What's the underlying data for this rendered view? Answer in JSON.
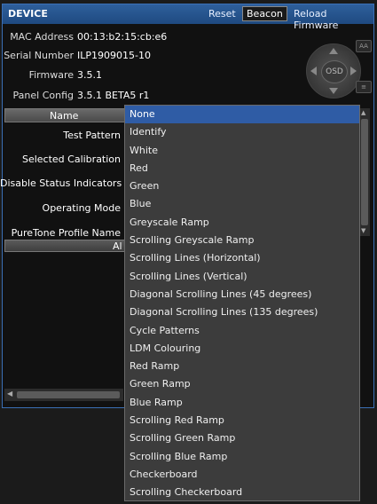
{
  "header": {
    "title": "DEVICE",
    "reset_label": "Reset",
    "beacon_label": "Beacon",
    "reload_label": "Reload Firmware"
  },
  "info": [
    {
      "label": "MAC Address",
      "value": "00:13:b2:15:cb:e6"
    },
    {
      "label": "Serial Number",
      "value": "ILP1909015-10"
    },
    {
      "label": "Firmware",
      "value": "3.5.1"
    },
    {
      "label": "Panel Config",
      "value": "3.5.1 BETA5 r1"
    }
  ],
  "osd": {
    "label": "OSD",
    "icon": "dpad-icon"
  },
  "table": {
    "name_header": "Name",
    "rows": [
      {
        "label": "Test Pattern"
      },
      {
        "label": "Selected Calibration"
      },
      {
        "label": "Disable Status Indicators"
      },
      {
        "label": "Operating Mode"
      },
      {
        "label": "PureTone Profile Name"
      }
    ],
    "footer_label": "Al"
  },
  "dropdown": {
    "selected": "None",
    "options": [
      "None",
      "Identify",
      "White",
      "Red",
      "Green",
      "Blue",
      "Greyscale Ramp",
      "Scrolling Greyscale Ramp",
      "Scrolling Lines (Horizontal)",
      "Scrolling Lines (Vertical)",
      "Diagonal Scrolling Lines (45 degrees)",
      "Diagonal Scrolling Lines (135 degrees)",
      "Cycle Patterns",
      "LDM Colouring",
      "Red Ramp",
      "Green Ramp",
      "Blue Ramp",
      "Scrolling Red Ramp",
      "Scrolling Green Ramp",
      "Scrolling Blue Ramp",
      "Checkerboard",
      "Scrolling Checkerboard"
    ]
  },
  "colors": {
    "header_bg": "#2e5f9c",
    "selected_bg": "#2f5ca5",
    "dropdown_bg": "#3c3c3c"
  }
}
